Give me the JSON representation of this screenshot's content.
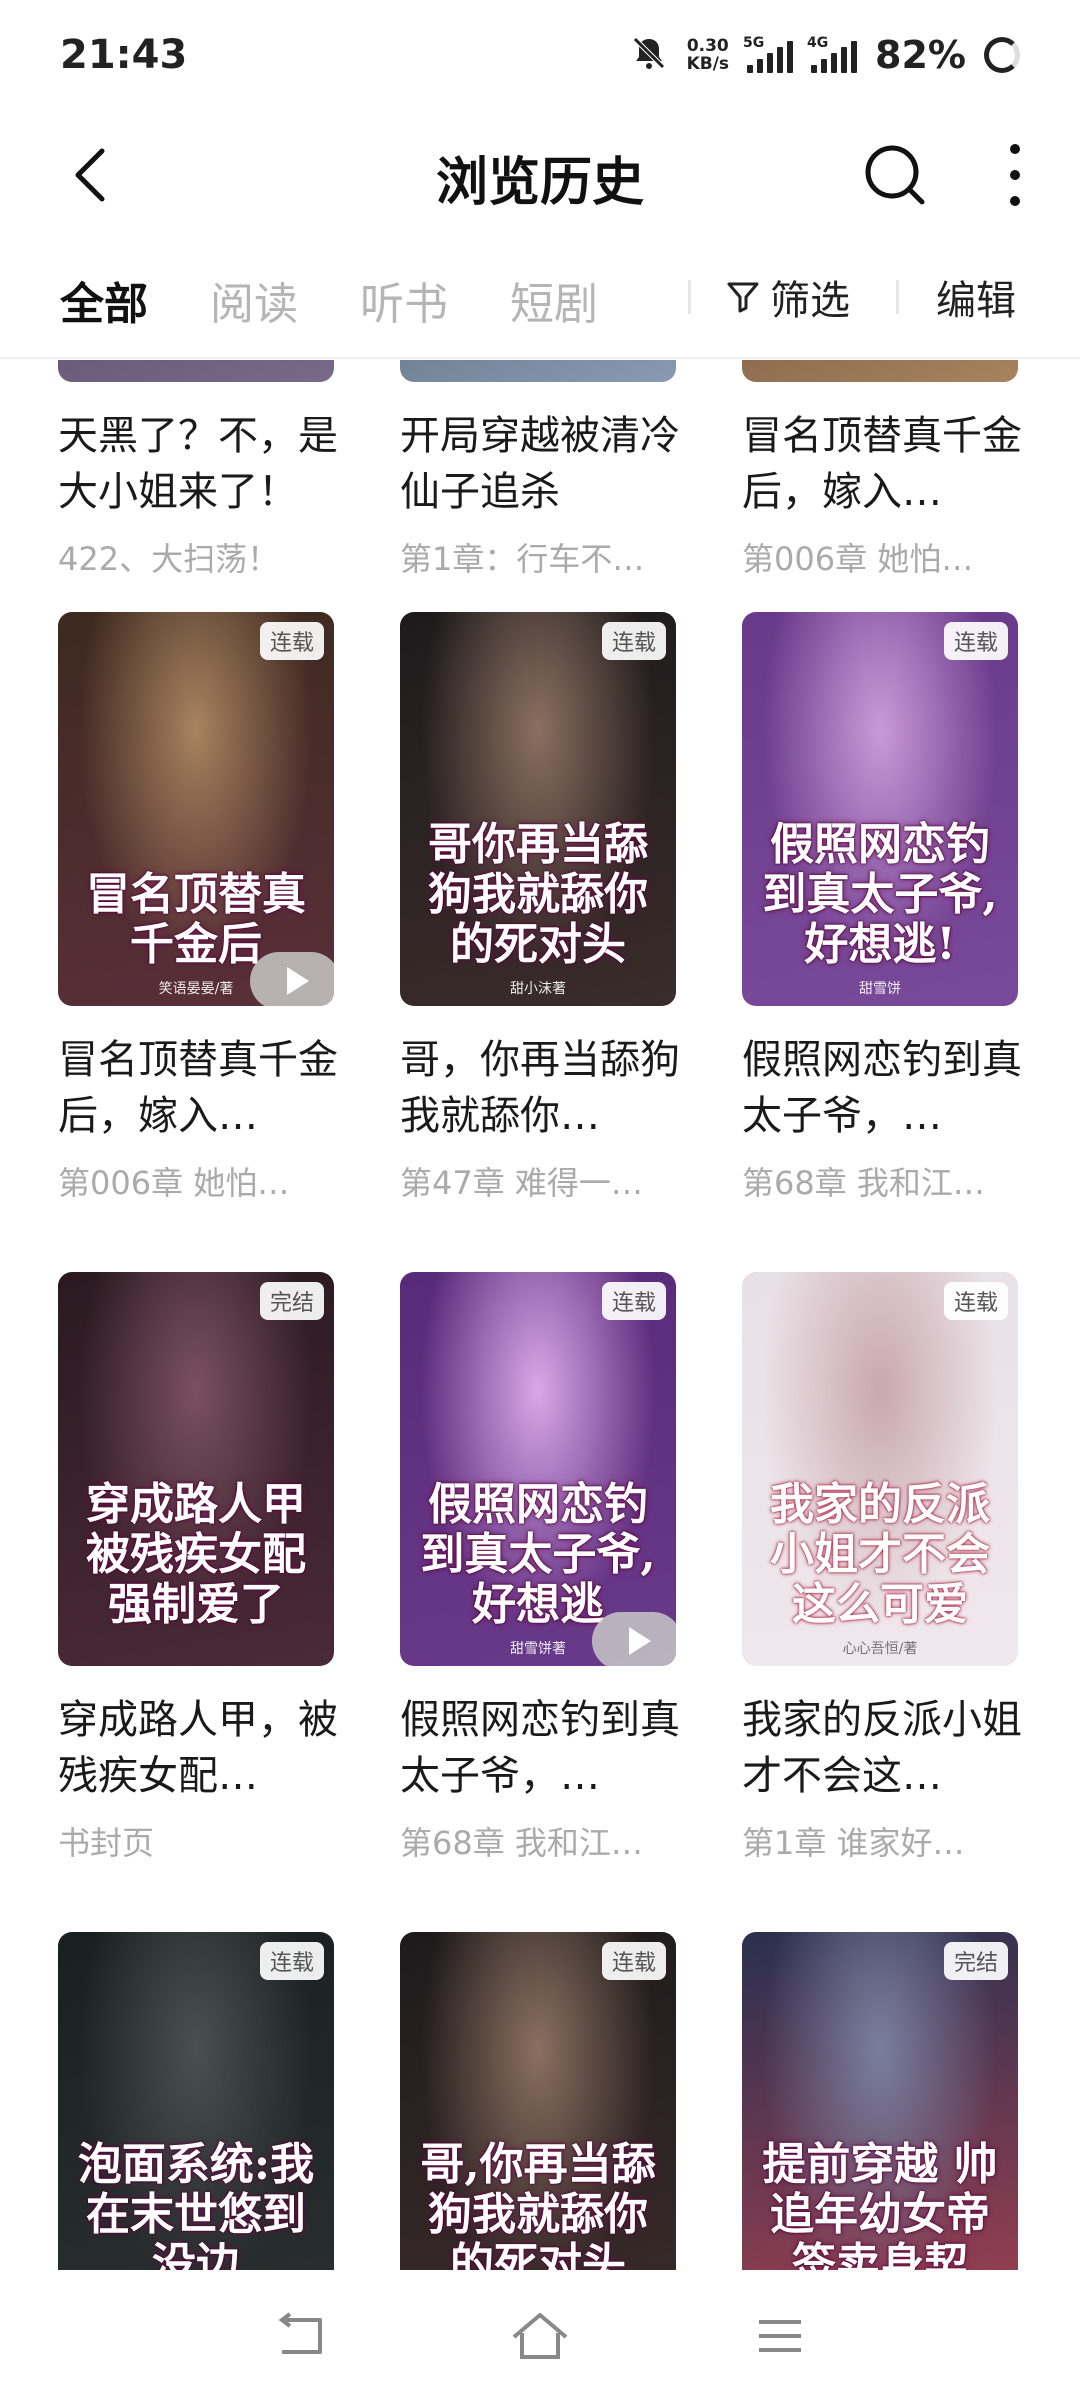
{
  "status": {
    "time": "21:43",
    "speed_value": "0.30",
    "speed_unit": "KB/s",
    "sig1": "5G",
    "sig2": "4G",
    "battery": "82%"
  },
  "header": {
    "title": "浏览历史"
  },
  "tabs": [
    {
      "label": "全部",
      "active": true
    },
    {
      "label": "阅读",
      "active": false
    },
    {
      "label": "听书",
      "active": false
    },
    {
      "label": "短剧",
      "active": false
    }
  ],
  "toolbar": {
    "filter_label": "筛选",
    "edit_label": "编辑"
  },
  "books": [
    {
      "title": "天黑了？不，是大小姐来了！",
      "progress": "422、大扫荡！"
    },
    {
      "title": "开局穿越被清冷仙子追杀",
      "progress": "第1章：行车不…"
    },
    {
      "title": "冒名顶替真千金后，嫁入…",
      "progress": "第006章 她怕…"
    },
    {
      "title": "冒名顶替真千金后，嫁入…",
      "progress": "第006章 她怕…",
      "badge": "连载",
      "cover_title": "冒名顶替真千金后",
      "cover_author": "笑语晏晏/著",
      "cover_colors": [
        "#3d2a1f",
        "#a8835e",
        "#5a2f3a"
      ]
    },
    {
      "title": "哥，你再当舔狗我就舔你…",
      "progress": "第47章 难得一…",
      "badge": "连载",
      "cover_title": "哥你再当舔狗我就舔你的死对头",
      "cover_author": "甜小沫著",
      "cover_colors": [
        "#1e1a1c",
        "#8a7060",
        "#3a2c2a"
      ]
    },
    {
      "title": "假照网恋钓到真太子爷，…",
      "progress": "第68章 我和江…",
      "badge": "连载",
      "cover_title": "假照网恋钓到真太子爷,好想逃!",
      "cover_author": "甜雪饼",
      "cover_colors": [
        "#6a3a8a",
        "#c99ad8",
        "#7a4a9a"
      ]
    },
    {
      "title": "穿成路人甲，被残疾女配…",
      "progress": "书封页",
      "badge": "完结",
      "cover_title": "穿成路人甲被残疾女配强制爱了",
      "cover_author": "",
      "cover_colors": [
        "#2a1a20",
        "#7a5060",
        "#4a2a38"
      ]
    },
    {
      "title": "假照网恋钓到真太子爷，…",
      "progress": "第68章 我和江…",
      "badge": "连载",
      "cover_title": "假照网恋钓到真太子爷,好想逃",
      "cover_author": "甜雪饼著",
      "cover_colors": [
        "#5a2a7a",
        "#d8a8e8",
        "#6a3a8a"
      ]
    },
    {
      "title": "我家的反派小姐才不会这…",
      "progress": "第1章 谁家好…",
      "badge": "连载",
      "cover_title": "我家的反派小姐才不会这么可爱",
      "cover_author": "心心吾恒/著",
      "cover_colors": [
        "#e8e0e4",
        "#c9a8b0",
        "#f0e8ec"
      ]
    },
    {
      "title": "",
      "progress": "",
      "badge": "连载",
      "cover_title": "泡面系统:我在末世悠到没边",
      "cover_author": "",
      "cover_colors": [
        "#1a2020",
        "#4a5050",
        "#2a3030"
      ]
    },
    {
      "title": "",
      "progress": "",
      "badge": "连载",
      "cover_title": "哥,你再当舔狗我就舔你的死对头",
      "cover_author": "",
      "cover_colors": [
        "#1e1a1c",
        "#8a7060",
        "#3a2c2a"
      ]
    },
    {
      "title": "",
      "progress": "",
      "badge": "完结",
      "cover_title": "提前穿越 帅追年幼女帝签卖身契",
      "cover_author": "",
      "cover_colors": [
        "#2a3050",
        "#7a80a0",
        "#a04050"
      ]
    }
  ]
}
